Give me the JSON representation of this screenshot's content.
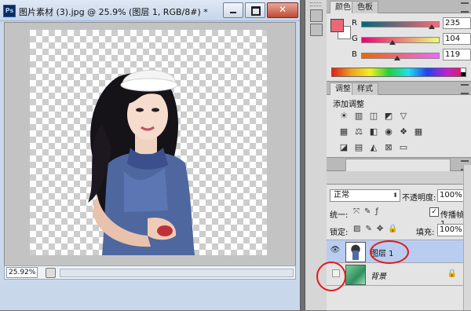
{
  "document": {
    "ps_badge": "Ps",
    "title": "图片素材 (3).jpg @ 25.9% (图层 1, RGB/8#) *",
    "buttons": {
      "minimize": "—",
      "maximize": "□",
      "close": "✕"
    },
    "zoom": "25.92%"
  },
  "color_panel": {
    "tabs": [
      "颜色",
      "色板"
    ],
    "foreground_color": "#eb6877",
    "background_color": "#ffffff",
    "channels": [
      {
        "label": "R",
        "value": "235",
        "fraction": 0.92
      },
      {
        "label": "G",
        "value": "104",
        "fraction": 0.41
      },
      {
        "label": "B",
        "value": "119",
        "fraction": 0.47
      }
    ]
  },
  "adjustments_panel": {
    "tabs": [
      "调整",
      "样式"
    ],
    "title": "添加调整",
    "rows": [
      [
        "sun-icon",
        "levels-icon",
        "curves-icon",
        "exposure-icon",
        "triangle-icon"
      ],
      [
        "vibrance-icon",
        "balance-icon",
        "bw-icon",
        "photo-filter-icon",
        "mixer-icon",
        "lookup-icon"
      ],
      [
        "invert-icon",
        "posterize-icon",
        "threshold-icon",
        "selective-color-icon",
        "gradient-map-icon"
      ]
    ]
  },
  "layers_panel": {
    "blend_mode": "正常",
    "opacity_label": "不透明度:",
    "opacity": "100%",
    "unify_label": "统一:",
    "propagate_label": "传播帧 1",
    "propagate_checked": "✓",
    "lock_label": "锁定:",
    "fill_label": "填充:",
    "fill": "100%",
    "layers": [
      {
        "name": "图层 1",
        "visible": "👁",
        "selected": true
      },
      {
        "name": "背景",
        "visible": "",
        "selected": false,
        "locked": "🔒"
      }
    ]
  },
  "annotation_color": "#e21a1a"
}
